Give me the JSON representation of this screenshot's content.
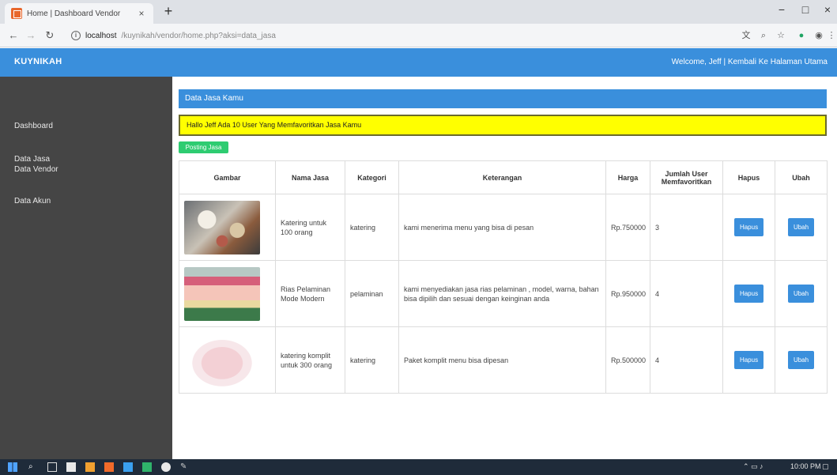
{
  "browser": {
    "tab_title": "Home | Dashboard Vendor",
    "tab_close": "×",
    "new_tab": "+",
    "url_host": "localhost",
    "url_path": "/kuynikah/vendor/home.php?aksi=data_jasa",
    "win_min": "−",
    "win_max": "□",
    "win_close": "×"
  },
  "header": {
    "brand": "KUYNIKAH",
    "welcome_prefix": "Welcome, Jeff | ",
    "welcome_link": "Kembali Ke Halaman Utama"
  },
  "sidebar": {
    "items": [
      {
        "label": "Dashboard"
      },
      {
        "label": "Data Jasa"
      },
      {
        "label": "Data Vendor"
      },
      {
        "label": "Data Akun"
      }
    ]
  },
  "main": {
    "panel_title": "Data Jasa Kamu",
    "alert": "Hallo Jeff Ada 10 User Yang Memfavoritkan Jasa Kamu",
    "add_button": "Posting Jasa",
    "columns": [
      "Gambar",
      "Nama Jasa",
      "Kategori",
      "Keterangan",
      "Harga",
      "Jumlah User Memfavoritkan",
      "Hapus",
      "Ubah"
    ],
    "rows": [
      {
        "nama": "Katering untuk 100 orang",
        "kategori": "katering",
        "keterangan": "kami menerima menu yang bisa di pesan",
        "harga": "Rp.750000",
        "jumlah": "3",
        "hapus": "Hapus",
        "ubah": "Ubah"
      },
      {
        "nama": "Rias Pelaminan Mode Modern",
        "kategori": "pelaminan",
        "keterangan": "kami menyediakan jasa rias pelaminan , model, warna, bahan bisa dipilih dan sesuai dengan keinginan anda",
        "harga": "Rp.950000",
        "jumlah": "4",
        "hapus": "Hapus",
        "ubah": "Ubah"
      },
      {
        "nama": "katering komplit untuk 300 orang",
        "kategori": "katering",
        "keterangan": "Paket komplit menu bisa dipesan",
        "harga": "Rp.500000",
        "jumlah": "4",
        "hapus": "Hapus",
        "ubah": "Ubah"
      }
    ]
  },
  "taskbar": {
    "time": "10:00 PM"
  },
  "colors": {
    "accent": "#3a8fdc",
    "sidebar": "#454545",
    "alert_bg": "#ffff00",
    "add_button": "#2ecc71"
  }
}
